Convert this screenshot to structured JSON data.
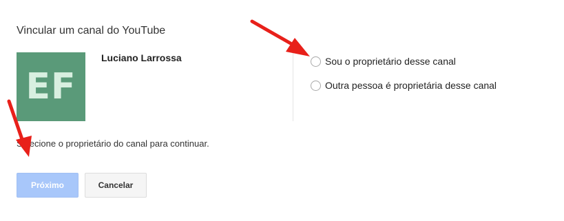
{
  "dialog": {
    "title": "Vincular um canal do YouTube",
    "channel": {
      "avatar_text": "EF",
      "avatar_color": "#5a9a79",
      "name": "Luciano Larrossa"
    },
    "options": [
      {
        "label": "Sou o proprietário desse canal",
        "selected": false
      },
      {
        "label": "Outra pessoa é proprietária desse canal",
        "selected": false
      }
    ],
    "hint": "Selecione o proprietário do canal para continuar.",
    "buttons": {
      "next_label": "Próximo",
      "cancel_label": "Cancelar"
    }
  },
  "annotations": {
    "arrow_color": "#e8201a"
  }
}
